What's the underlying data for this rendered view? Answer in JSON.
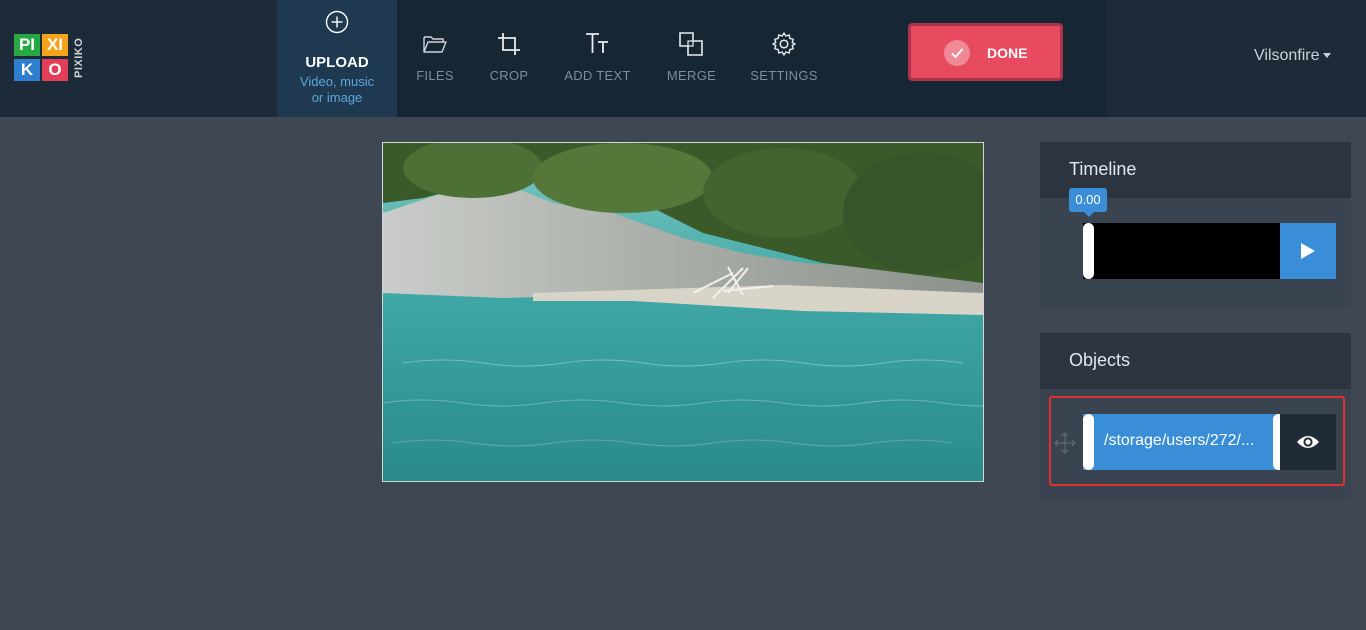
{
  "app": {
    "logo_tiles": [
      "PI",
      "XI",
      "K",
      "O"
    ],
    "logo_side_text": "PIXIKO"
  },
  "toolbar": {
    "upload": {
      "title": "UPLOAD",
      "subtitle_line1": "Video, music",
      "subtitle_line2": "or image",
      "icon": "plus-circle-icon"
    },
    "tools": [
      {
        "label": "FILES",
        "icon": "folder-icon"
      },
      {
        "label": "CROP",
        "icon": "crop-icon"
      },
      {
        "label": "ADD TEXT",
        "icon": "text-icon"
      },
      {
        "label": "MERGE",
        "icon": "merge-icon"
      },
      {
        "label": "SETTINGS",
        "icon": "gear-icon"
      }
    ],
    "done_label": "DONE",
    "user_name": "Vilsonfire"
  },
  "timeline": {
    "title": "Timeline",
    "current_time": "0.00"
  },
  "objects": {
    "title": "Objects",
    "items": [
      {
        "path": "/storage/users/272/..."
      }
    ]
  },
  "colors": {
    "accent": "#3a8ed8",
    "done": "#e84a5f",
    "topbar": "#1d2b38",
    "background": "#3f4753",
    "highlight": "#e0312f"
  }
}
